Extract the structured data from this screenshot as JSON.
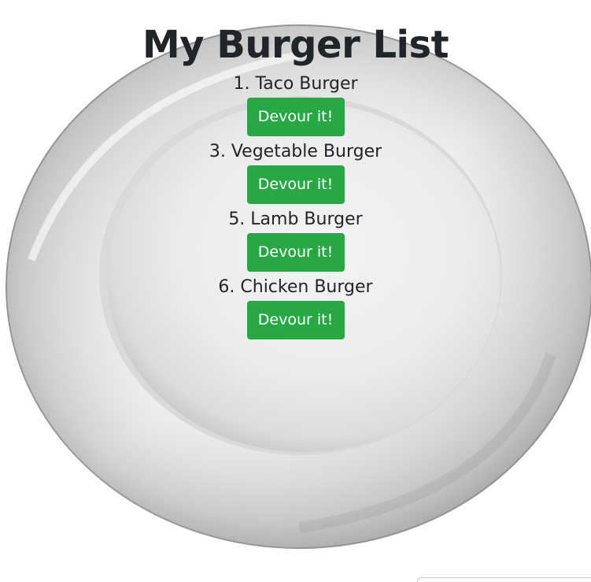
{
  "page": {
    "title": "My Burger List"
  },
  "burgers": [
    {
      "label": "1. Taco Burger",
      "button_label": "Devour it!"
    },
    {
      "label": "3. Vegetable Burger",
      "button_label": "Devour it!"
    },
    {
      "label": "5. Lamb Burger",
      "button_label": "Devour it!"
    },
    {
      "label": "6. Chicken Burger",
      "button_label": "Devour it!"
    }
  ],
  "colors": {
    "button_bg": "#28a745",
    "button_text": "#ffffff",
    "text": "#212529"
  }
}
